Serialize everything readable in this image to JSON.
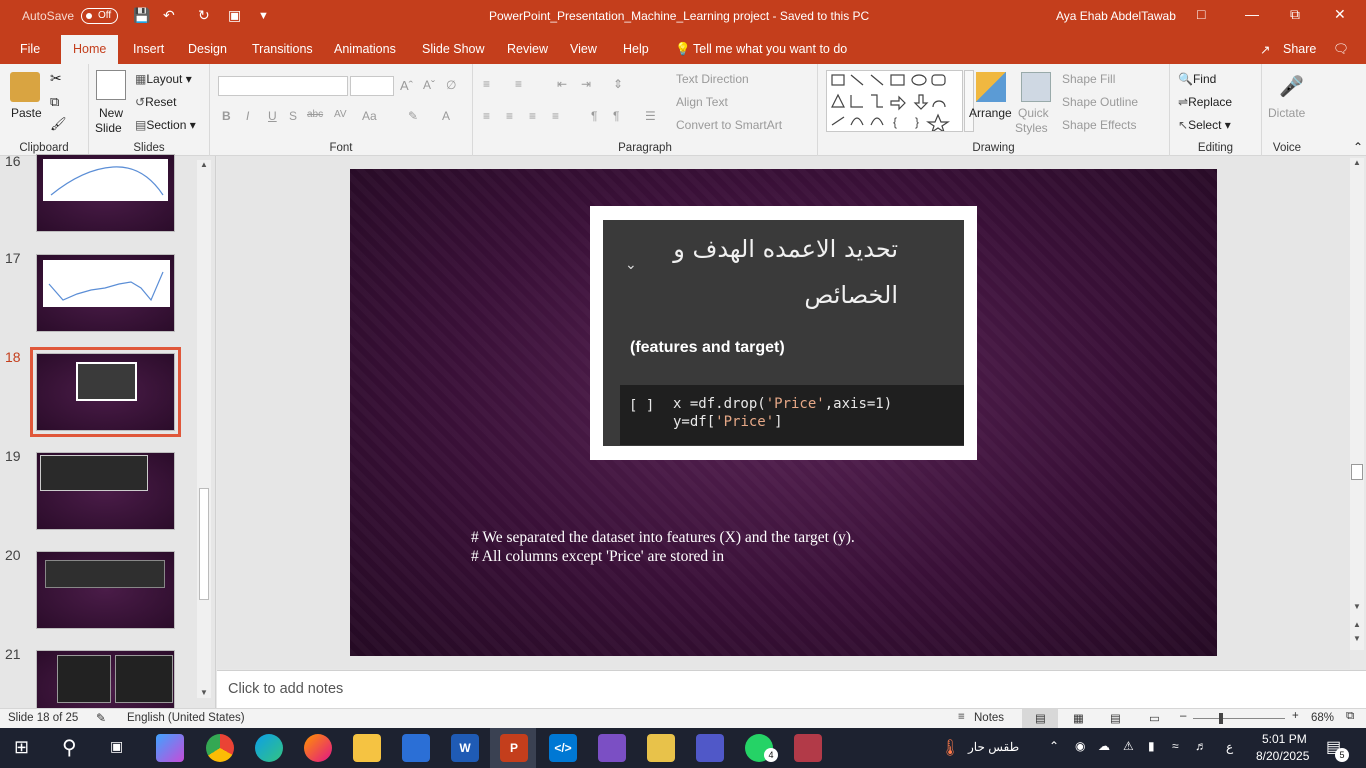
{
  "titlebar": {
    "autosave_label": "AutoSave",
    "autosave_state": "Off",
    "document_title": "PowerPoint_Presentation_Machine_Learning project  -  Saved to this PC",
    "user_name": "Aya Ehab AbdelTawab"
  },
  "tabs": [
    "File",
    "Home",
    "Insert",
    "Design",
    "Transitions",
    "Animations",
    "Slide Show",
    "Review",
    "View",
    "Help"
  ],
  "active_tab": "Home",
  "tell_me": "Tell me what you want to do",
  "share": "Share",
  "ribbon": {
    "clipboard": {
      "paste": "Paste",
      "label": "Clipboard"
    },
    "slides": {
      "new_slide_1": "New",
      "new_slide_2": "Slide",
      "layout": "Layout",
      "reset": "Reset",
      "section": "Section",
      "label": "Slides"
    },
    "font": {
      "bold": "B",
      "italic": "I",
      "underline": "U",
      "shadow": "S",
      "strike": "abc",
      "spacing": "AV",
      "case": "Aa",
      "label": "Font"
    },
    "paragraph": {
      "text_direction": "Text Direction",
      "align_text": "Align Text",
      "convert_smartart": "Convert to SmartArt",
      "label": "Paragraph"
    },
    "drawing": {
      "arrange": "Arrange",
      "quick_styles_1": "Quick",
      "quick_styles_2": "Styles",
      "shape_fill": "Shape Fill",
      "shape_outline": "Shape Outline",
      "shape_effects": "Shape Effects",
      "label": "Drawing"
    },
    "editing": {
      "find": "Find",
      "replace": "Replace",
      "select": "Select",
      "label": "Editing"
    },
    "voice": {
      "dictate": "Dictate",
      "label": "Voice"
    }
  },
  "slides_panel": {
    "numbers": [
      "16",
      "17",
      "18",
      "19",
      "20",
      "21"
    ],
    "selected": "18"
  },
  "slide": {
    "arabic_title_line1": "تحديد الاعمده الهدف و",
    "arabic_title_line2": "الخصائص",
    "features_label": "(features and target)",
    "code_brackets": "[ ]",
    "code_line1_a": "x =df.drop(",
    "code_line1_str": "'Price'",
    "code_line1_b": ",axis=1)",
    "code_line2_a": "y=df[",
    "code_line2_str": "'Price'",
    "code_line2_b": "]",
    "text_line1": "# We separated the dataset into features (X) and the target (y).",
    "text_line2": "# All columns except 'Price' are stored in"
  },
  "notes_placeholder": "Click to add notes",
  "status": {
    "slide_info": "Slide 18 of 25",
    "language": "English (United States)",
    "notes": "Notes",
    "zoom": "68%"
  },
  "taskbar": {
    "weather": "طقس حار",
    "time": "5:01 PM",
    "date": "8/20/2025",
    "notification_count": "5",
    "whatsapp_badge": "4",
    "lang": "ع"
  },
  "colors": {
    "accent": "#c43e1c",
    "slide_bg": "#3a1038",
    "selected_outline": "#e0573a"
  }
}
